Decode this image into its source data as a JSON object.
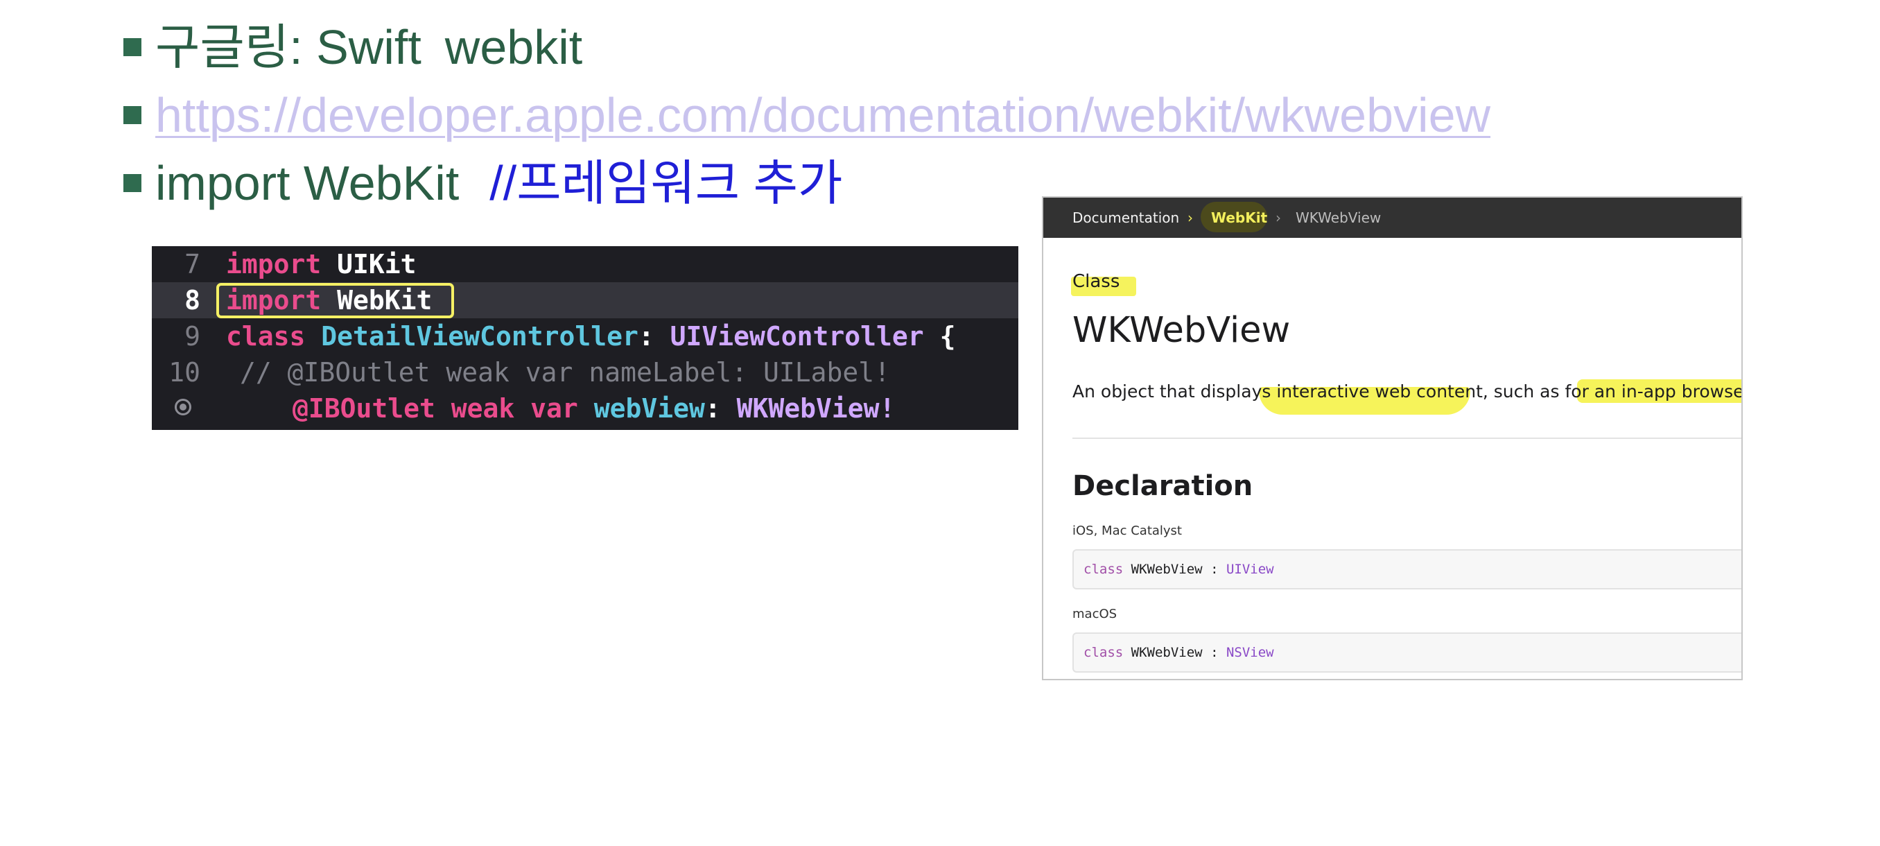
{
  "bullets": {
    "line1": {
      "label": "구글링: Swift",
      "term": "webkit"
    },
    "line2": {
      "url": "https://developer.apple.com/documentation/webkit/wkwebview"
    },
    "line3": {
      "code": "import WebKit",
      "comment": "//프레임워크 추가"
    }
  },
  "code_editor": {
    "rows": [
      {
        "line": "7",
        "kw": "import",
        "rest": "UIKit"
      },
      {
        "line": "8",
        "kw": "import",
        "rest": "WebKit"
      },
      {
        "line": "9",
        "kw": "class",
        "type": "DetailViewController",
        "sep": ":",
        "super": "UIViewController",
        "brace": "{"
      },
      {
        "line": "10",
        "comment": "//   @IBOutlet weak var nameLabel: UILabel!"
      },
      {
        "attr": "@IBOutlet weak var",
        "name": "webView",
        "sep": ":",
        "type": "WKWebView!"
      }
    ]
  },
  "doc": {
    "breadcrumb": [
      "Documentation",
      "WebKit",
      "WKWebView"
    ],
    "breadcrumb_sep": "›",
    "kind": "Class",
    "title": "WKWebView",
    "description": "An object that displays interactive web content, such as for an in-app browser.",
    "section": "Declaration",
    "platforms": [
      {
        "name": "iOS, Mac Catalyst",
        "kw": "class",
        "cls": "WKWebView",
        "sep": ":",
        "super": "UIView"
      },
      {
        "name": "macOS",
        "kw": "class",
        "cls": "WKWebView",
        "sep": ":",
        "super": "NSView"
      }
    ]
  },
  "colors": {
    "heading_green": "#2b5e45",
    "link_lavender": "#c9c3ee",
    "comment_blue": "#1f1fd6",
    "highlight_yellow": "#f5f35d",
    "code_bg": "#1e1e23",
    "keyword_pink": "#ea4c8d"
  }
}
